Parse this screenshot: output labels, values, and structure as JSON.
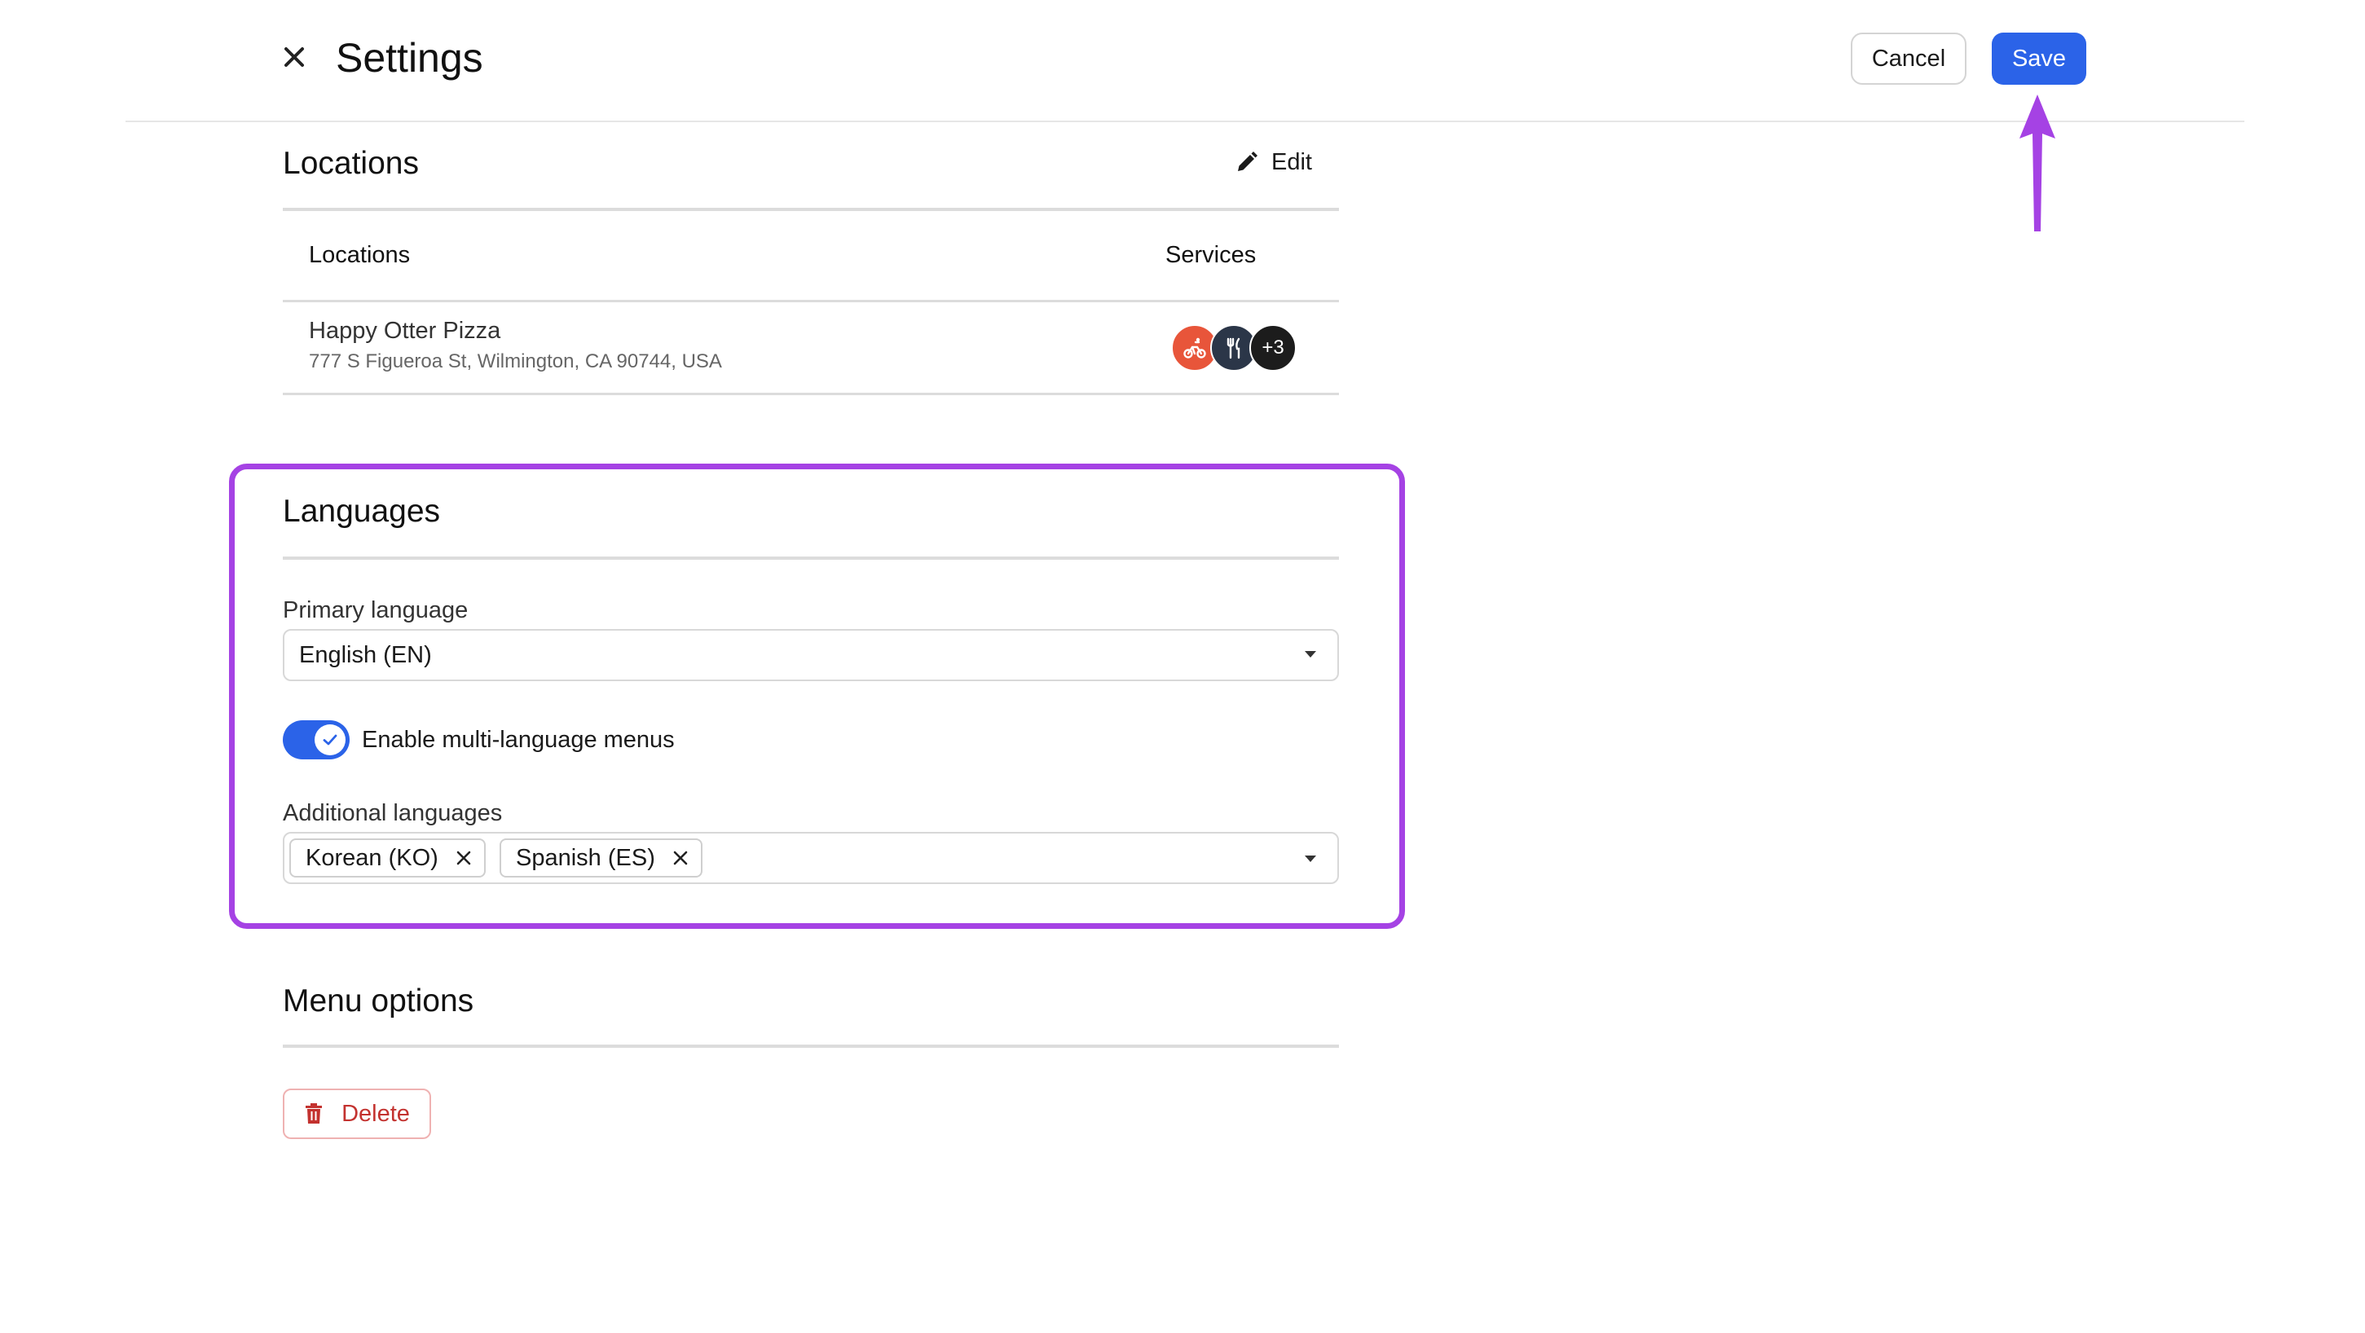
{
  "header": {
    "title": "Settings",
    "cancel_label": "Cancel",
    "save_label": "Save",
    "close_icon": "close-icon",
    "accent_color": "#2b63e8"
  },
  "locations": {
    "title": "Locations",
    "edit_label": "Edit",
    "columns": [
      "Locations",
      "Services"
    ],
    "rows": [
      {
        "name": "Happy Otter Pizza",
        "address": "777 S Figueroa St, Wilmington, CA 90744, USA",
        "services": [
          {
            "icon": "delivery-bike-icon",
            "color": "#e8553a"
          },
          {
            "icon": "fork-knife-icon",
            "color": "#2b3648"
          }
        ],
        "more_services": "+3"
      }
    ]
  },
  "languages": {
    "title": "Languages",
    "primary_label": "Primary language",
    "primary_value": "English (EN)",
    "multi_language_label": "Enable multi-language menus",
    "multi_language_enabled": true,
    "additional_label": "Additional languages",
    "additional_values": [
      "Korean (KO)",
      "Spanish (ES)"
    ],
    "highlight_color": "#a542e4"
  },
  "menu_options": {
    "title": "Menu options",
    "delete_label": "Delete",
    "delete_color": "#c3322f"
  },
  "annotation": {
    "arrow_color": "#a542e4"
  }
}
